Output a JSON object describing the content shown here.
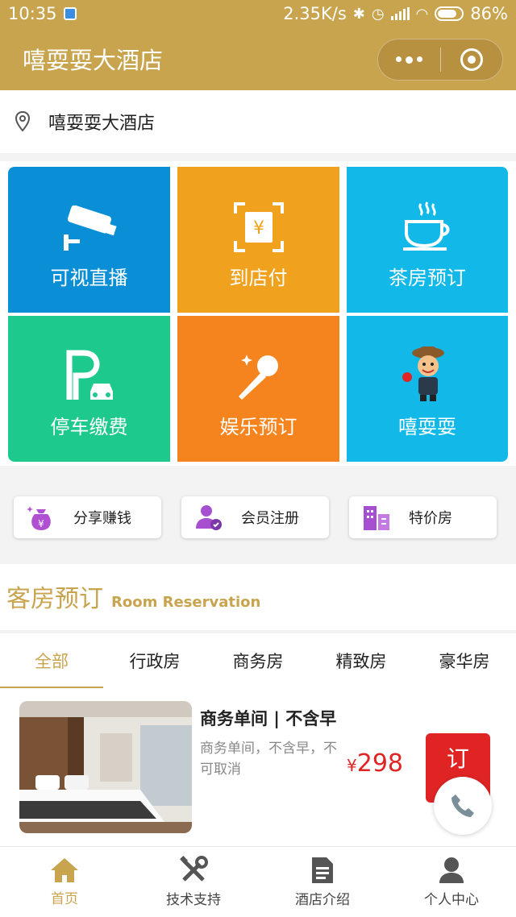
{
  "status_bar": {
    "time": "10:35",
    "network_speed": "2.35K/s",
    "battery": "86%"
  },
  "nav": {
    "title": "嘻耍耍大酒店"
  },
  "location": {
    "hotel_name": "嘻耍耍大酒店"
  },
  "tiles": [
    {
      "label": "可视直播",
      "color": "#0a8fd6",
      "icon": "cctv-camera-icon"
    },
    {
      "label": "到店付",
      "color": "#f0a21e",
      "icon": "yuan-scan-icon"
    },
    {
      "label": "茶房预订",
      "color": "#11b8e8",
      "icon": "coffee-cup-icon"
    },
    {
      "label": "停车缴费",
      "color": "#1ec98d",
      "icon": "parking-car-icon"
    },
    {
      "label": "娱乐预订",
      "color": "#f5841f",
      "icon": "microphone-icon"
    },
    {
      "label": "嘻耍耍",
      "color": "#11b8e8",
      "icon": "mascot-icon"
    }
  ],
  "quick_actions": [
    {
      "label": "分享赚钱",
      "icon": "money-bag-icon"
    },
    {
      "label": "会员注册",
      "icon": "member-icon"
    },
    {
      "label": "特价房",
      "icon": "building-icon"
    }
  ],
  "section": {
    "title_cn": "客房预订",
    "title_en": "Room Reservation"
  },
  "room_tabs": [
    "全部",
    "行政房",
    "商务房",
    "精致房",
    "豪华房"
  ],
  "room": {
    "title": "商务单间 | 不含早",
    "description": "商务单间，不含早，不可取消",
    "currency": "¥",
    "price": "298",
    "book_label": "订"
  },
  "tabbar": [
    {
      "label": "首页",
      "icon": "home-icon",
      "active": true
    },
    {
      "label": "技术支持",
      "icon": "tools-icon",
      "active": false
    },
    {
      "label": "酒店介绍",
      "icon": "document-icon",
      "active": false
    },
    {
      "label": "个人中心",
      "icon": "user-icon",
      "active": false
    }
  ],
  "colors": {
    "brand_gold": "#c9a44e",
    "price_red": "#e02424"
  }
}
